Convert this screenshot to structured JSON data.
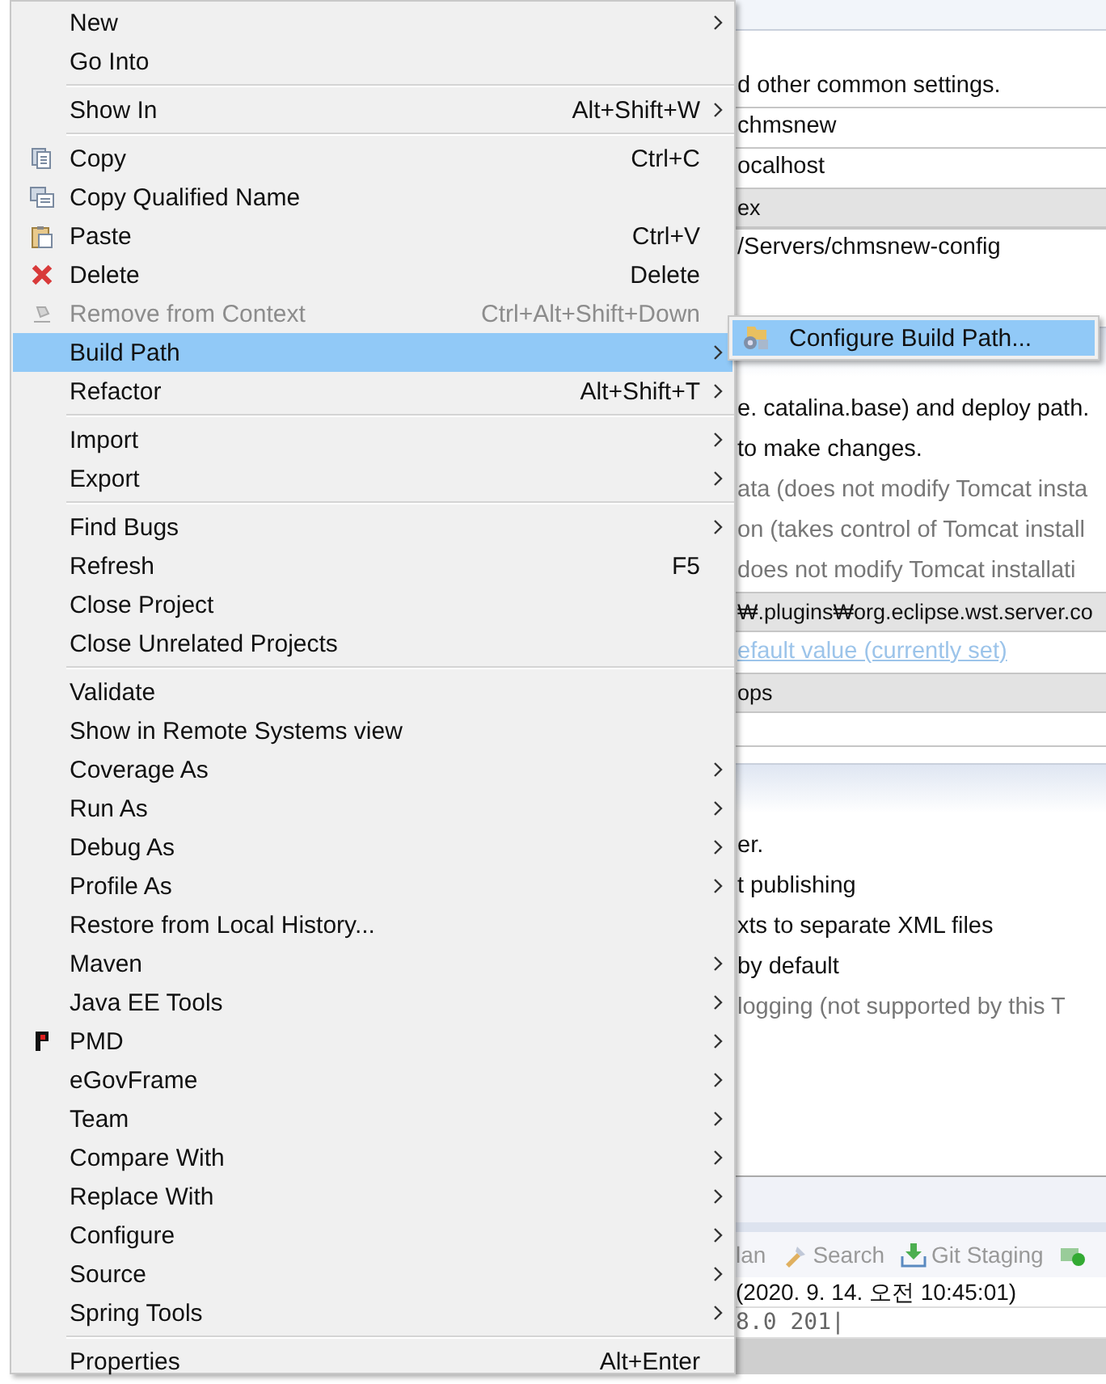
{
  "editor": {
    "sections": [
      {
        "rows": [
          {
            "kind": "text",
            "text": "d other common settings."
          },
          {
            "kind": "field",
            "text": "chmsnew"
          },
          {
            "kind": "field",
            "text": "ocalhost"
          },
          {
            "kind": "readonly",
            "text": "ex"
          },
          {
            "kind": "field",
            "text": "/Servers/chmsnew-config"
          }
        ]
      },
      {
        "rows": [
          {
            "kind": "text",
            "text": "e. catalina.base) and deploy path."
          },
          {
            "kind": "text",
            "text": "to make changes."
          },
          {
            "kind": "muted",
            "text": "ata (does not modify Tomcat insta"
          },
          {
            "kind": "muted",
            "text": "on (takes control of Tomcat install"
          },
          {
            "kind": "muted",
            "text": "does not modify Tomcat installati"
          },
          {
            "kind": "readonly",
            "text": "₩.plugins₩org.eclipse.wst.server.co"
          },
          {
            "kind": "link",
            "text": "efault value (currently set)"
          },
          {
            "kind": "readonly",
            "text": "ops"
          }
        ]
      },
      {
        "rows": [
          {
            "kind": "text",
            "text": "er."
          },
          {
            "kind": "text",
            "text": "t publishing"
          },
          {
            "kind": "text",
            "text": "xts to separate XML files"
          },
          {
            "kind": "text",
            "text": "by default"
          },
          {
            "kind": "muted",
            "text": "logging (not supported by this T"
          }
        ]
      }
    ]
  },
  "views": {
    "tabs": [
      {
        "kind": "plain",
        "label": "lan"
      },
      {
        "kind": "search",
        "label": "Search"
      },
      {
        "kind": "git",
        "label": "Git Staging"
      },
      {
        "kind": "run"
      }
    ]
  },
  "console": {
    "lines": [
      "(2020. 9. 14. 오전 10:45:01)",
      "8.0 201|"
    ]
  },
  "menu": {
    "items": [
      {
        "kind": "item",
        "label": "New",
        "submenu": true,
        "selected": false,
        "disabled": false
      },
      {
        "kind": "item",
        "label": "Go Into",
        "selected": false,
        "disabled": false
      },
      {
        "kind": "separator"
      },
      {
        "kind": "item",
        "label": "Show In",
        "shortcut": "Alt+Shift+W",
        "submenu": true,
        "selected": false,
        "disabled": false
      },
      {
        "kind": "separator"
      },
      {
        "kind": "copy",
        "label": "Copy",
        "shortcut": "Ctrl+C",
        "selected": false,
        "disabled": false
      },
      {
        "kind": "copyname",
        "label": "Copy Qualified Name",
        "selected": false,
        "disabled": false
      },
      {
        "kind": "paste",
        "label": "Paste",
        "shortcut": "Ctrl+V",
        "selected": false,
        "disabled": false
      },
      {
        "kind": "delete",
        "label": "Delete",
        "shortcut": "Delete",
        "selected": false,
        "disabled": false
      },
      {
        "kind": "remove",
        "label": "Remove from Context",
        "shortcut": "Ctrl+Alt+Shift+Down",
        "selected": false,
        "disabled": true
      },
      {
        "kind": "item",
        "label": "Build Path",
        "submenu": true,
        "selected": true,
        "disabled": false
      },
      {
        "kind": "item",
        "label": "Refactor",
        "shortcut": "Alt+Shift+T",
        "submenu": true,
        "selected": false,
        "disabled": false
      },
      {
        "kind": "separator"
      },
      {
        "kind": "item",
        "label": "Import",
        "submenu": true,
        "selected": false,
        "disabled": false
      },
      {
        "kind": "item",
        "label": "Export",
        "submenu": true,
        "selected": false,
        "disabled": false
      },
      {
        "kind": "separator"
      },
      {
        "kind": "item",
        "label": "Find Bugs",
        "submenu": true,
        "selected": false,
        "disabled": false
      },
      {
        "kind": "item",
        "label": "Refresh",
        "shortcut": "F5",
        "selected": false,
        "disabled": false
      },
      {
        "kind": "item",
        "label": "Close Project",
        "selected": false,
        "disabled": false
      },
      {
        "kind": "item",
        "label": "Close Unrelated Projects",
        "selected": false,
        "disabled": false
      },
      {
        "kind": "separator"
      },
      {
        "kind": "item",
        "label": "Validate",
        "selected": false,
        "disabled": false
      },
      {
        "kind": "item",
        "label": "Show in Remote Systems view",
        "selected": false,
        "disabled": false
      },
      {
        "kind": "item",
        "label": "Coverage As",
        "submenu": true,
        "selected": false,
        "disabled": false
      },
      {
        "kind": "item",
        "label": "Run As",
        "submenu": true,
        "selected": false,
        "disabled": false
      },
      {
        "kind": "item",
        "label": "Debug As",
        "submenu": true,
        "selected": false,
        "disabled": false
      },
      {
        "kind": "item",
        "label": "Profile As",
        "submenu": true,
        "selected": false,
        "disabled": false
      },
      {
        "kind": "item",
        "label": "Restore from Local History...",
        "selected": false,
        "disabled": false
      },
      {
        "kind": "item",
        "label": "Maven",
        "submenu": true,
        "selected": false,
        "disabled": false
      },
      {
        "kind": "item",
        "label": "Java EE Tools",
        "submenu": true,
        "selected": false,
        "disabled": false
      },
      {
        "kind": "pmd",
        "label": "PMD",
        "submenu": true,
        "selected": false,
        "disabled": false
      },
      {
        "kind": "item",
        "label": "eGovFrame",
        "submenu": true,
        "selected": false,
        "disabled": false
      },
      {
        "kind": "item",
        "label": "Team",
        "submenu": true,
        "selected": false,
        "disabled": false
      },
      {
        "kind": "item",
        "label": "Compare With",
        "submenu": true,
        "selected": false,
        "disabled": false
      },
      {
        "kind": "item",
        "label": "Replace With",
        "submenu": true,
        "selected": false,
        "disabled": false
      },
      {
        "kind": "item",
        "label": "Configure",
        "submenu": true,
        "selected": false,
        "disabled": false
      },
      {
        "kind": "item",
        "label": "Source",
        "submenu": true,
        "selected": false,
        "disabled": false
      },
      {
        "kind": "item",
        "label": "Spring Tools",
        "submenu": true,
        "selected": false,
        "disabled": false
      },
      {
        "kind": "separator"
      },
      {
        "kind": "item",
        "label": "Properties",
        "shortcut": "Alt+Enter",
        "selected": false,
        "disabled": false
      }
    ]
  },
  "submenu": {
    "items": [
      {
        "kind": "build-path",
        "label": "Configure Build Path...",
        "selected": true
      }
    ]
  }
}
